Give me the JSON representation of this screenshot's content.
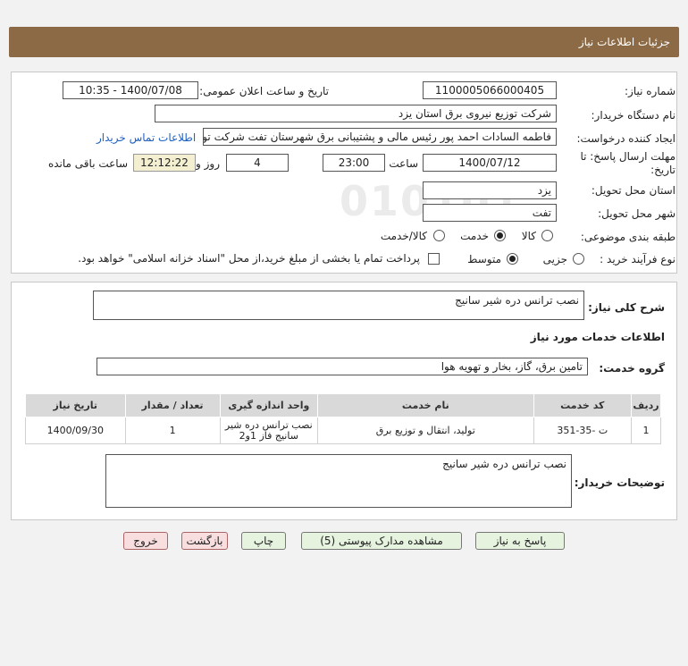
{
  "header": {
    "title": "جزئیات اطلاعات نیاز"
  },
  "form": {
    "need_number_label": "شماره نیاز:",
    "need_number": "1100005066000405",
    "announce_label": "تاریخ و ساعت اعلان عمومی:",
    "announce_value": "1400/07/08 - 10:35",
    "buyer_org_label": "نام دستگاه خریدار:",
    "buyer_org": "شرکت توزیع نیروی برق استان یزد",
    "requester_label": "ایجاد کننده درخواست:",
    "requester": "فاطمه السادات  احمد پور  رئیس مالی و پشتیبانی برق شهرستان تفت شرکت توزیع",
    "contact_link": "اطلاعات تماس خریدار",
    "deadline_label": "مهلت ارسال پاسخ: تا",
    "deadline_label2": "تاریخ:",
    "deadline_date": "1400/07/12",
    "time_label": "ساعت",
    "deadline_time": "23:00",
    "days_value": "4",
    "days_label": "روز و",
    "remaining_time": "12:12:22",
    "remaining_label": "ساعت باقی مانده",
    "province_label": "استان محل تحویل:",
    "province": "یزد",
    "city_label": "شهر محل تحویل:",
    "city": "تفت",
    "category_label": "طبقه بندی موضوعی:",
    "category_options": [
      "کالا",
      "خدمت",
      "کالا/خدمت"
    ],
    "category_selected": "خدمت",
    "process_label": "نوع فرآیند خرید :",
    "process_options": [
      "جزیی",
      "متوسط"
    ],
    "process_selected": "متوسط",
    "payment_note": "پرداخت تمام یا بخشی از مبلغ خرید،از محل \"اسناد خزانه اسلامی\" خواهد بود."
  },
  "summary": {
    "label": "شرح کلی نیاز:",
    "value": "نصب ترانس دره شیر سانیج"
  },
  "services": {
    "section_title": "اطلاعات خدمات مورد نیاز",
    "group_label": "گروه خدمت:",
    "group_value": "تامین برق، گاز، بخار و تهویه هوا",
    "columns": [
      "ردیف",
      "کد خدمت",
      "نام خدمت",
      "واحد اندازه گیری",
      "تعداد / مقدار",
      "تاریخ نیاز"
    ],
    "rows": [
      {
        "index": "1",
        "code": "ت -35-351",
        "name": "تولید، انتقال و توزیع برق",
        "unit": "نصب ترانس دره شیر سانیج فاز 1و2",
        "qty": "1",
        "date": "1400/09/30"
      }
    ]
  },
  "buyer_notes": {
    "label": "توضیحات خریدار:",
    "value": "نصب ترانس دره شیر سانیج"
  },
  "buttons": {
    "respond": "پاسخ به نیاز",
    "attachments": "مشاهده مدارک پیوستی (5)",
    "print": "چاپ",
    "back": "بازگشت",
    "exit": "خروج"
  }
}
